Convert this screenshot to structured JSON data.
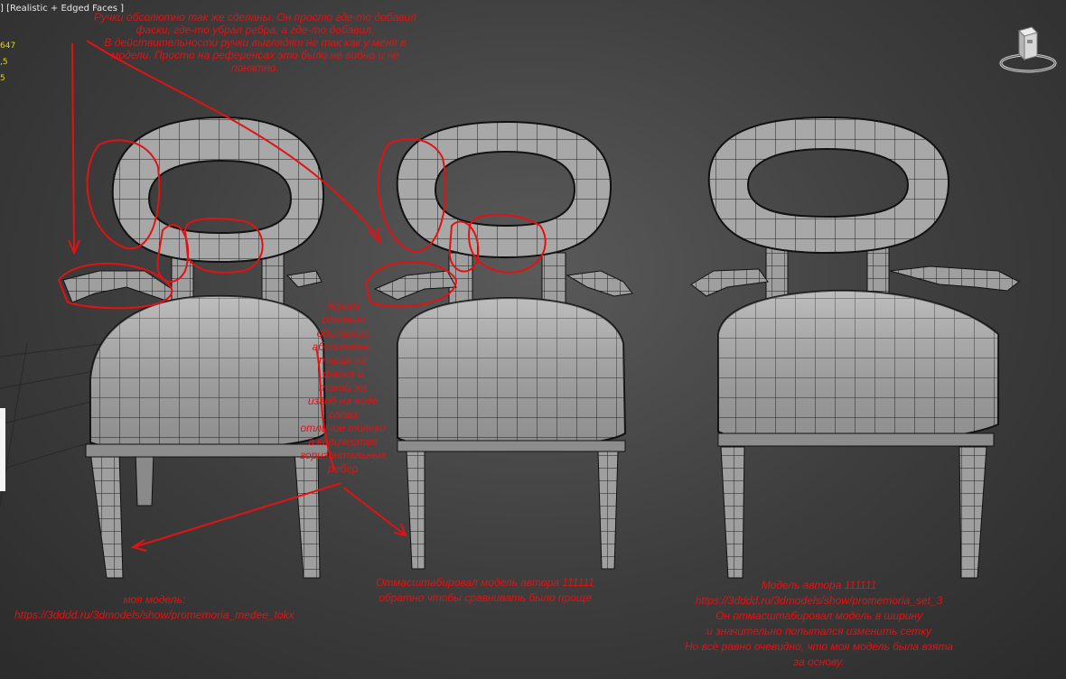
{
  "viewport": {
    "label_prefix": "[ ",
    "bracket_close": "]",
    "shading_mode": "[Realistic + Edged Faces ]"
  },
  "stats": [
    "647",
    ",5",
    "5"
  ],
  "notes": {
    "handles": [
      "Ручки обсолютно так же сделаны. Он просто где-то добавил",
      "фаски, где-то убрал ребра, а где-то добавил.",
      "В действительности ручки выглядят не так как у меня в",
      "модели. Просто на референсах это было не видно и не",
      "понятно."
    ],
    "legs": [
      "Ножки",
      "сделаны",
      "одинаково",
      "абсолютно,",
      "такая же",
      "фаска и",
      "такой же",
      "изгиб на виде",
      "слева",
      "отличие только",
      "в количестве",
      "горизонтальных",
      "ребер"
    ],
    "my_model": [
      "моя модель:",
      "https://3dddd.ru/3dmodels/show/promemoria_medee_tokx"
    ],
    "rescaled": [
      "Отмасштабировал модель автора 111111",
      "обратно чтобы сравнивать было проще"
    ],
    "author": [
      "Модель автора 111111",
      "https://3dddd.ru/3dmodels/show/promemoria_set_3",
      "Он отмасштабировал модель в ширину",
      "и значительно попытался изменить сетку",
      "Но всё равно очевидно, что моя модель была взята",
      "за основу."
    ]
  },
  "colors": {
    "annotation": "#e21212",
    "mesh_fill": "#9a9a9a",
    "mesh_edge": "#1a1a1a",
    "stats": "#e6d600"
  },
  "icons": [
    "viewcube-icon"
  ]
}
